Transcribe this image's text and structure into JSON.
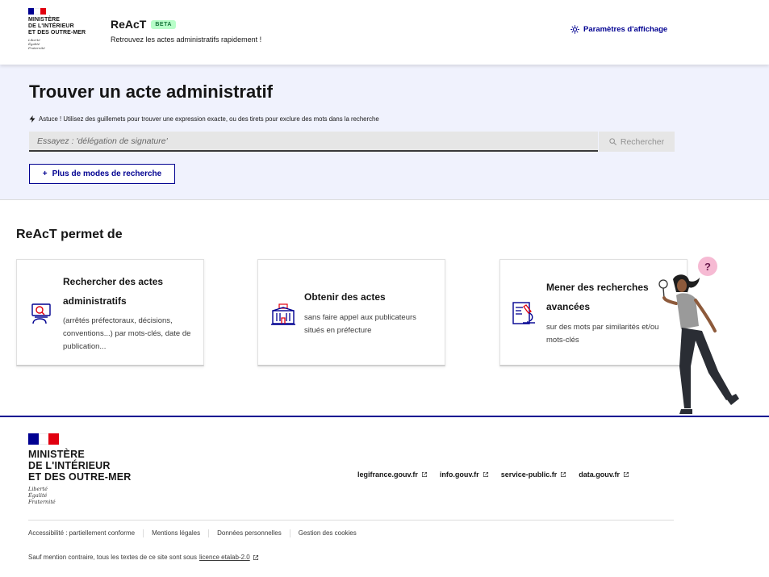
{
  "header": {
    "ministry_lines": [
      "MINISTÈRE",
      "DE L'INTÉRIEUR",
      "ET DES OUTRE-MER"
    ],
    "motto_lines": [
      "Liberté",
      "Égalité",
      "Fraternité"
    ],
    "brand_name": "ReAcT",
    "beta_badge": "BETA",
    "tagline": "Retrouvez les actes administratifs rapidement !",
    "display_settings_label": "Paramètres d'affichage"
  },
  "search": {
    "title": "Trouver un acte administratif",
    "tip": "Astuce ! Utilisez des guillemets pour trouver une expression exacte, ou des tirets pour exclure des mots dans la recherche",
    "placeholder": "Essayez : 'délégation de signature'",
    "value": "",
    "button_label": "Rechercher",
    "more_modes_label": "Plus de modes de recherche",
    "more_modes_icon": "+"
  },
  "features": {
    "title": "ReAcT permet de",
    "cards": [
      {
        "icon": "search-document-icon",
        "title": "Rechercher des actes administratifs",
        "description": "(arrêtés préfectoraux, décisions, conventions...) par mots-clés, date de publication..."
      },
      {
        "icon": "prefecture-building-icon",
        "title": "Obtenir des actes",
        "description": "sans faire appel aux publicateurs situés en préfecture"
      },
      {
        "icon": "microscope-document-icon",
        "title": "Mener des recherches avancées",
        "description": "sur des mots par similarités et/ou mots-clés"
      }
    ]
  },
  "footer": {
    "ministry_lines": [
      "MINISTÈRE",
      "DE L'INTÉRIEUR",
      "ET DES OUTRE-MER"
    ],
    "motto_lines": [
      "Liberté",
      "Égalité",
      "Fraternité"
    ],
    "links": [
      {
        "label": "legifrance.gouv.fr"
      },
      {
        "label": "info.gouv.fr"
      },
      {
        "label": "service-public.fr"
      },
      {
        "label": "data.gouv.fr"
      }
    ],
    "bottom_links": [
      {
        "label": "Accessibilité : partiellement conforme"
      },
      {
        "label": "Mentions légales"
      },
      {
        "label": "Données personnelles"
      },
      {
        "label": "Gestion des cookies"
      }
    ],
    "license_text": "Sauf mention contraire, tous les textes de ce site sont sous",
    "license_link": "licence etalab-2.0"
  },
  "colors": {
    "primary_blue": "#000091",
    "marianne_red": "#e1000f",
    "search_bg": "#f0f2fd",
    "beta_bg": "#b8fec9",
    "beta_text": "#18753c",
    "illustration_pink": "#f4a9c8"
  }
}
